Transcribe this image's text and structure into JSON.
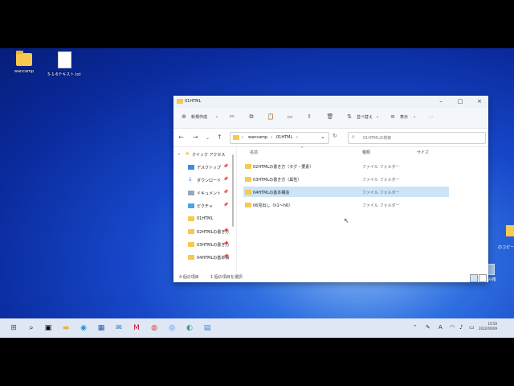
{
  "desktop": {
    "icons": [
      {
        "label": "wancamp",
        "icon": "folder-icon"
      },
      {
        "label": "5-1-6テキスト.txt",
        "icon": "text-file-icon"
      }
    ],
    "recycle_bin": "ごみ箱",
    "partial_label": "のコピー"
  },
  "explorer": {
    "title": "01HTML",
    "window_controls": [
      "minimize",
      "maximize",
      "close"
    ],
    "toolbar": {
      "new_label": "新規作成",
      "sort_label": "並べ替え",
      "view_label": "表示",
      "more_label": "…"
    },
    "address": {
      "crumbs": [
        "wancamp",
        "01HTML"
      ]
    },
    "search": {
      "placeholder": "01HTMLの検索"
    },
    "nav_pane": {
      "quick_access": "クイック アクセス",
      "items": [
        {
          "label": "デスクトップ",
          "icon": "desktop-icon",
          "pinned": true
        },
        {
          "label": "ダウンロード",
          "icon": "download-icon",
          "pinned": true
        },
        {
          "label": "ドキュメント",
          "icon": "document-icon",
          "pinned": true
        },
        {
          "label": "ピクチャ",
          "icon": "picture-icon",
          "pinned": true
        },
        {
          "label": "01HTML",
          "icon": "folder-icon",
          "pinned": false
        },
        {
          "label": "02HTMLの書き方",
          "icon": "folder-icon",
          "pinned": true
        },
        {
          "label": "03HTMLの書き方",
          "icon": "folder-icon",
          "pinned": true
        },
        {
          "label": "04HTMLの基本構",
          "icon": "folder-icon",
          "pinned": true
        }
      ]
    },
    "columns": [
      "名前",
      "種類",
      "サイズ"
    ],
    "rows": [
      {
        "name": "02HTMLの書き方（タグ・要素）",
        "type": "ファイル フォルダー",
        "selected": false
      },
      {
        "name": "03HTMLの書き方（属性）",
        "type": "ファイル フォルダー",
        "selected": false
      },
      {
        "name": "04HTMLの基本構造",
        "type": "ファイル フォルダー",
        "selected": true
      },
      {
        "name": "06見出し（h1〜h6）",
        "type": "ファイル フォルダー",
        "selected": false
      }
    ],
    "status": {
      "count": "4 個の項目",
      "selected": "1 個の項目を選択"
    }
  },
  "taskbar": {
    "apps": [
      "windows-start-icon",
      "search-icon",
      "task-view-icon",
      "file-explorer-icon",
      "edge-icon",
      "store-icon",
      "mail-icon",
      "mcafee-icon",
      "chrome-icon",
      "zoom-icon",
      "browser-icon",
      "notepad-icon"
    ],
    "clock_time": "10:50",
    "clock_date": "2022/06/09"
  },
  "colors": {
    "accent": "#0a5cd6",
    "selection": "#cce4f7",
    "folder": "#f6c94f",
    "taskbar": "#dfe7f4"
  }
}
